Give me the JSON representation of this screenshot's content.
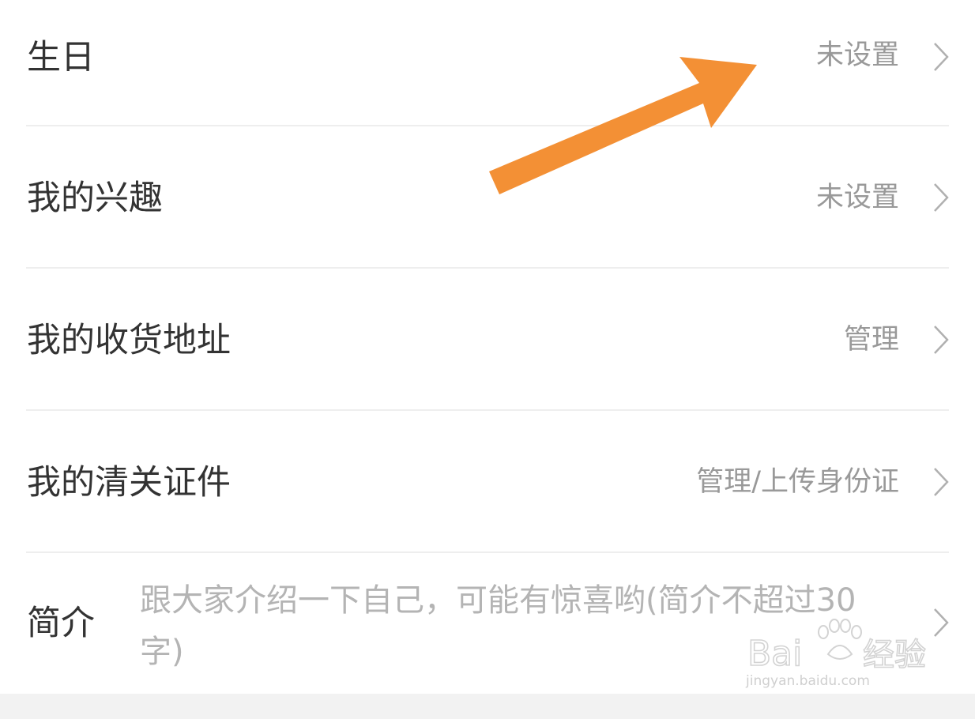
{
  "rows": [
    {
      "label": "生日",
      "value": "未设置"
    },
    {
      "label": "我的兴趣",
      "value": "未设置"
    },
    {
      "label": "我的收货地址",
      "value": "管理"
    },
    {
      "label": "我的清关证件",
      "value": "管理/上传身份证"
    }
  ],
  "intro": {
    "label": "简介",
    "placeholder": "跟大家介绍一下自己，可能有惊喜哟(简介不超过30字)"
  },
  "watermark": {
    "logo_text": "Baidu经验",
    "url": "jingyan.baidu.com"
  },
  "colors": {
    "annotation_arrow": "#F39035",
    "label": "#333333",
    "value": "#999999",
    "placeholder": "#B4B4B4",
    "divider": "#EEEEEE"
  },
  "icons": {
    "row_chevron": "chevron-right-icon",
    "annotation": "annotation-arrow"
  }
}
